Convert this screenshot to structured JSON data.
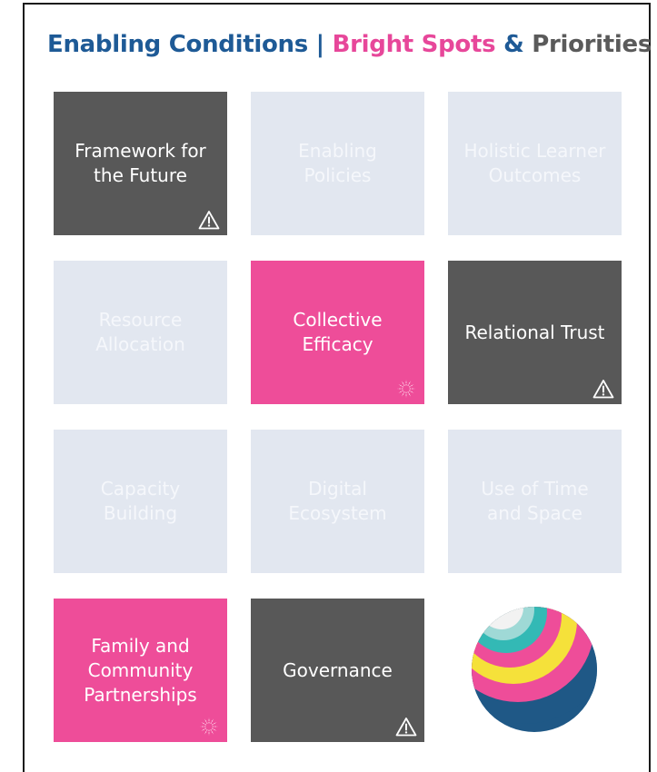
{
  "title": {
    "part1": "Enabling Conditions",
    "separator": "|",
    "part2": "Bright Spots",
    "amp": "&",
    "part3": "Priorities"
  },
  "colors": {
    "dark_tile": "#585858",
    "pink_tile": "#ee4d99",
    "light_tile": "#e2e7f0",
    "title_blue": "#1e5a96",
    "title_pink": "#e7479a",
    "title_gray": "#5a5a5a"
  },
  "tiles": [
    {
      "label": "Framework for\nthe Future",
      "style": "dark",
      "badge": "warning-icon"
    },
    {
      "label": "Enabling\nPolicies",
      "style": "light",
      "badge": ""
    },
    {
      "label": "Holistic Learner\nOutcomes",
      "style": "light",
      "badge": ""
    },
    {
      "label": "Resource\nAllocation",
      "style": "light",
      "badge": ""
    },
    {
      "label": "Collective\nEfficacy",
      "style": "pink",
      "badge": "sparkle-icon"
    },
    {
      "label": "Relational Trust",
      "style": "dark",
      "badge": "warning-icon"
    },
    {
      "label": "Capacity\nBuilding",
      "style": "light",
      "badge": ""
    },
    {
      "label": "Digital\nEcosystem",
      "style": "light",
      "badge": ""
    },
    {
      "label": "Use of Time\nand Space",
      "style": "light",
      "badge": ""
    },
    {
      "label": "Family and\nCommunity\nPartnerships",
      "style": "pink",
      "badge": "sparkle-icon"
    },
    {
      "label": "Governance",
      "style": "dark",
      "badge": "warning-icon"
    }
  ],
  "logo": {
    "icon": "rainbow-sphere-logo"
  }
}
